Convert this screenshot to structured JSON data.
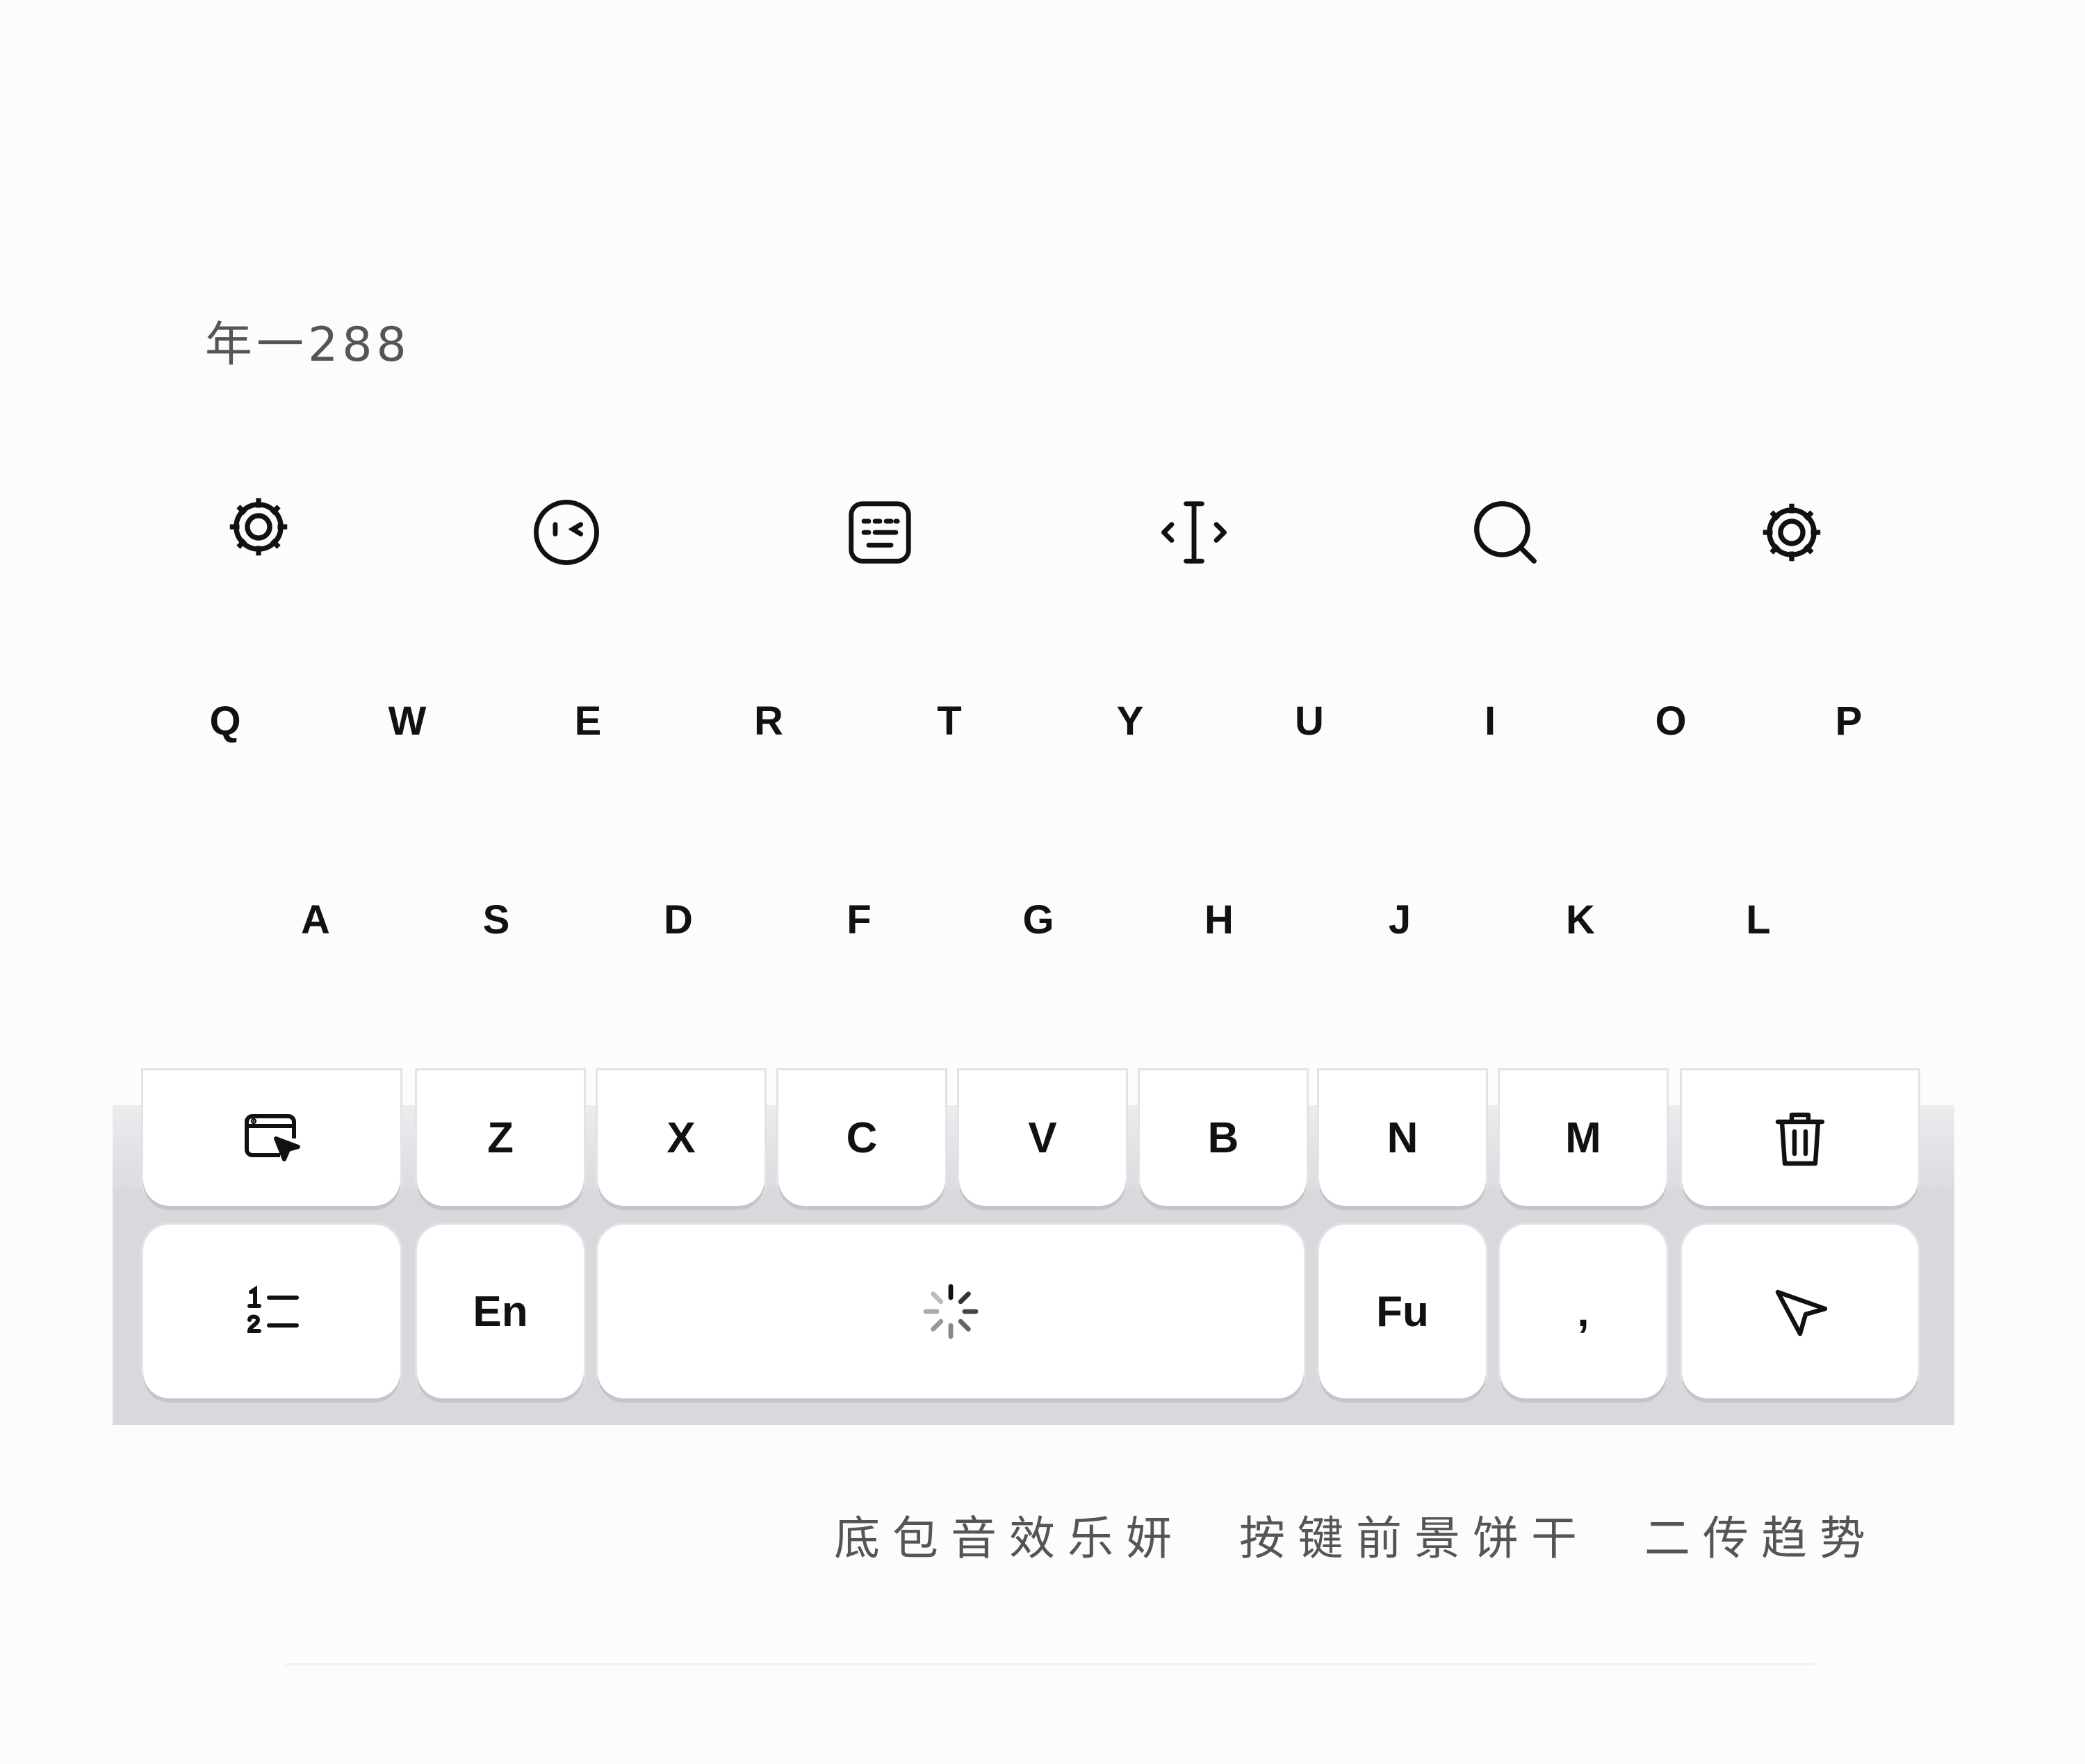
{
  "header": {
    "code_label": "年一288"
  },
  "toolbar": {
    "icons": [
      "gear-icon",
      "face-icon",
      "keyboard-icon",
      "cursor-icon",
      "search-icon",
      "gear-icon"
    ]
  },
  "keyboard": {
    "row1": [
      "Q",
      "W",
      "E",
      "R",
      "T",
      "Y",
      "U",
      "I",
      "O",
      "P"
    ],
    "row2": [
      "A",
      "S",
      "D",
      "F",
      "G",
      "H",
      "J",
      "K",
      "L"
    ],
    "row3": [
      "Z",
      "X",
      "C",
      "V",
      "B",
      "N",
      "M"
    ],
    "row4": {
      "lang": "En",
      "fu": "Fu",
      "comma": ","
    },
    "icons": {
      "row3_left": "cursor-select-icon",
      "row3_right": "trash-icon",
      "row4_left": "numbered-list-icon",
      "space": "loading-spinner-icon",
      "send": "send-arrow-icon"
    }
  },
  "caption": {
    "parts": [
      "底包音效乐妍",
      "按键前景饼干",
      "二传趋势"
    ]
  }
}
